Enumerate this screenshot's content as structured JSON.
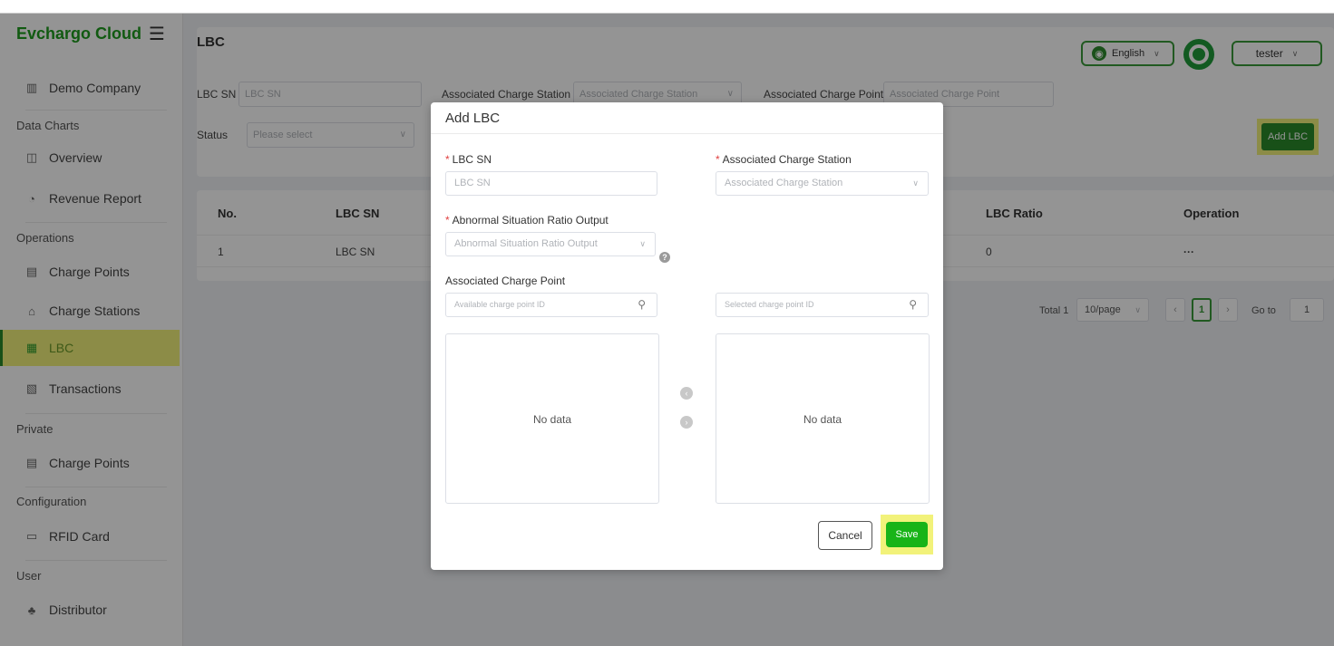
{
  "sidebar": {
    "logo": "Evchargo Cloud",
    "company": "Demo Company",
    "groups": {
      "data_charts": "Data Charts",
      "operations": "Operations",
      "private": "Private",
      "configuration": "Configuration",
      "user": "User"
    },
    "items": {
      "overview": "Overview",
      "revenue_report": "Revenue Report",
      "charge_points": "Charge Points",
      "charge_stations": "Charge Stations",
      "lbc": "LBC",
      "transactions": "Transactions",
      "private_charge_points": "Charge Points",
      "rfid_card": "RFID Card",
      "distributor": "Distributor"
    }
  },
  "header": {
    "language": "English",
    "user": "tester"
  },
  "page": {
    "title": "LBC",
    "filters": {
      "lbc_sn_label": "LBC SN",
      "lbc_sn_placeholder": "LBC SN",
      "station_label": "Associated Charge Station",
      "station_placeholder": "Associated Charge Station",
      "point_label": "Associated Charge Point",
      "point_placeholder": "Associated Charge Point",
      "status_label": "Status",
      "status_placeholder": "Please select"
    },
    "add_button": "Add LBC",
    "table": {
      "columns": {
        "no": "No.",
        "lbc_sn": "LBC SN",
        "lbc_ratio": "LBC Ratio",
        "operation": "Operation"
      },
      "rows": [
        {
          "no": "1",
          "lbc_sn": "LBC SN",
          "lbc_ratio": "0",
          "operation": "···"
        }
      ]
    },
    "pagination": {
      "total": "Total 1",
      "page_size": "10/page",
      "current_page": "1",
      "goto_label": "Go to",
      "goto_value": "1"
    }
  },
  "modal": {
    "title": "Add LBC",
    "lbc_sn_label": "LBC SN",
    "lbc_sn_placeholder": "LBC SN",
    "station_label": "Associated Charge Station",
    "station_placeholder": "Associated Charge Station",
    "ratio_label": "Abnormal Situation Ratio Output",
    "ratio_placeholder": "Abnormal Situation Ratio Output",
    "charge_point_label": "Associated Charge Point",
    "available_placeholder": "Available charge point ID",
    "selected_placeholder": "Selected charge point ID",
    "empty_left": "No data",
    "empty_right": "No data",
    "cancel": "Cancel",
    "save": "Save"
  },
  "colors": {
    "brand_green": "#1e9c1e",
    "highlight_yellow": "#f2f27a",
    "save_green": "#18b418"
  }
}
